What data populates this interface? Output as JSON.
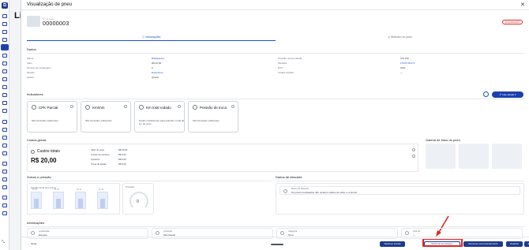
{
  "behind": {
    "page_title": "Li"
  },
  "modal": {
    "title": "Visualização de pneu",
    "id_label": "Nº de fogo",
    "tire_id": "00000003",
    "status": "SUCATEADO",
    "tabs": [
      {
        "label": "Informações",
        "active": true
      },
      {
        "label": "Histórico do pneu",
        "active": false
      }
    ]
  },
  "dados": {
    "title": "Dados",
    "left": [
      {
        "label": "Marca",
        "value": "Bridgestone",
        "link": true
      },
      {
        "label": "Valor",
        "value": "R$ 20,00",
        "link": false
      },
      {
        "label": "Número de recapagem",
        "value": "0",
        "link": false
      },
      {
        "label": "Modelo",
        "value": "Endurance",
        "link": true
      },
      {
        "label": "Quarto",
        "value": "Quarto",
        "link": false
      }
    ],
    "right": [
      {
        "label": "Pressão recomendada",
        "value": "100 PSI",
        "link": false
      },
      {
        "label": "Medidas",
        "value": "175/70 R13 3",
        "link": true
      },
      {
        "label": "DOT",
        "value": "2021",
        "link": false
      },
      {
        "label": "Código auxiliar",
        "value": "—",
        "link": false
      }
    ]
  },
  "indicadores": {
    "title": "Indicadores",
    "period": "1º mês (atual)",
    "cards": [
      {
        "title": "CPK Parcial",
        "text": "Não há dados suficientes"
      },
      {
        "title": "Km/mm",
        "text": "Não há dados suficientes"
      },
      {
        "title": "Km total rodado",
        "text": "Dados insuficientes para calcular o total de km do pneu"
      },
      {
        "title": "Pressão de troca",
        "text": "Não há dados suficientes"
      }
    ]
  },
  "custos": {
    "section": "Custos gerais",
    "card_title": "Custos totais",
    "total": "R$ 20,00",
    "rows": [
      {
        "label": "Valor do pneu",
        "value": "R$ 20,00"
      },
      {
        "label": "Custos de serviços",
        "value": "R$ 0,00"
      },
      {
        "label": "Conserto",
        "value": "R$ 0,00"
      },
      {
        "label": "Troca de banda",
        "value": "R$ 0,00"
      }
    ]
  },
  "galeria": {
    "title": "Galeria de fotos do pneu"
  },
  "sulcos": {
    "title": "Sulcos e pressão",
    "chart_caption": "Medida atual dos sulcos",
    "bars": [
      {
        "label": "0 / 0",
        "level": 0.6
      },
      {
        "label": "0 / 0",
        "level": 0.6
      },
      {
        "label": "0 / 0",
        "level": 0.6
      },
      {
        "label": "0 / 0",
        "level": 0.6
      }
    ],
    "gauge_label": "Pressão",
    "gauge_value": "0"
  },
  "descarte": {
    "title": "Dados de descarte",
    "box_label": "Motivo do descarte",
    "box_text": "Os pneus sucateados não recebem ações de sulco e contorno"
  },
  "informacoes": {
    "title": "Informações",
    "cards": [
      {
        "label": "Localização",
        "value": "Estoque"
      },
      {
        "label": "Condição",
        "value": "Não lavado"
      },
      {
        "label": "Categoria",
        "value": "Novo"
      },
      {
        "label": "Vida útil",
        "value": "—"
      }
    ]
  },
  "footer": {
    "back": "Voltar",
    "buttons": [
      "Reativar sucata",
      "Retornar ao estoque",
      "Remover permanentemente",
      "Duplicar",
      "Editar"
    ]
  }
}
